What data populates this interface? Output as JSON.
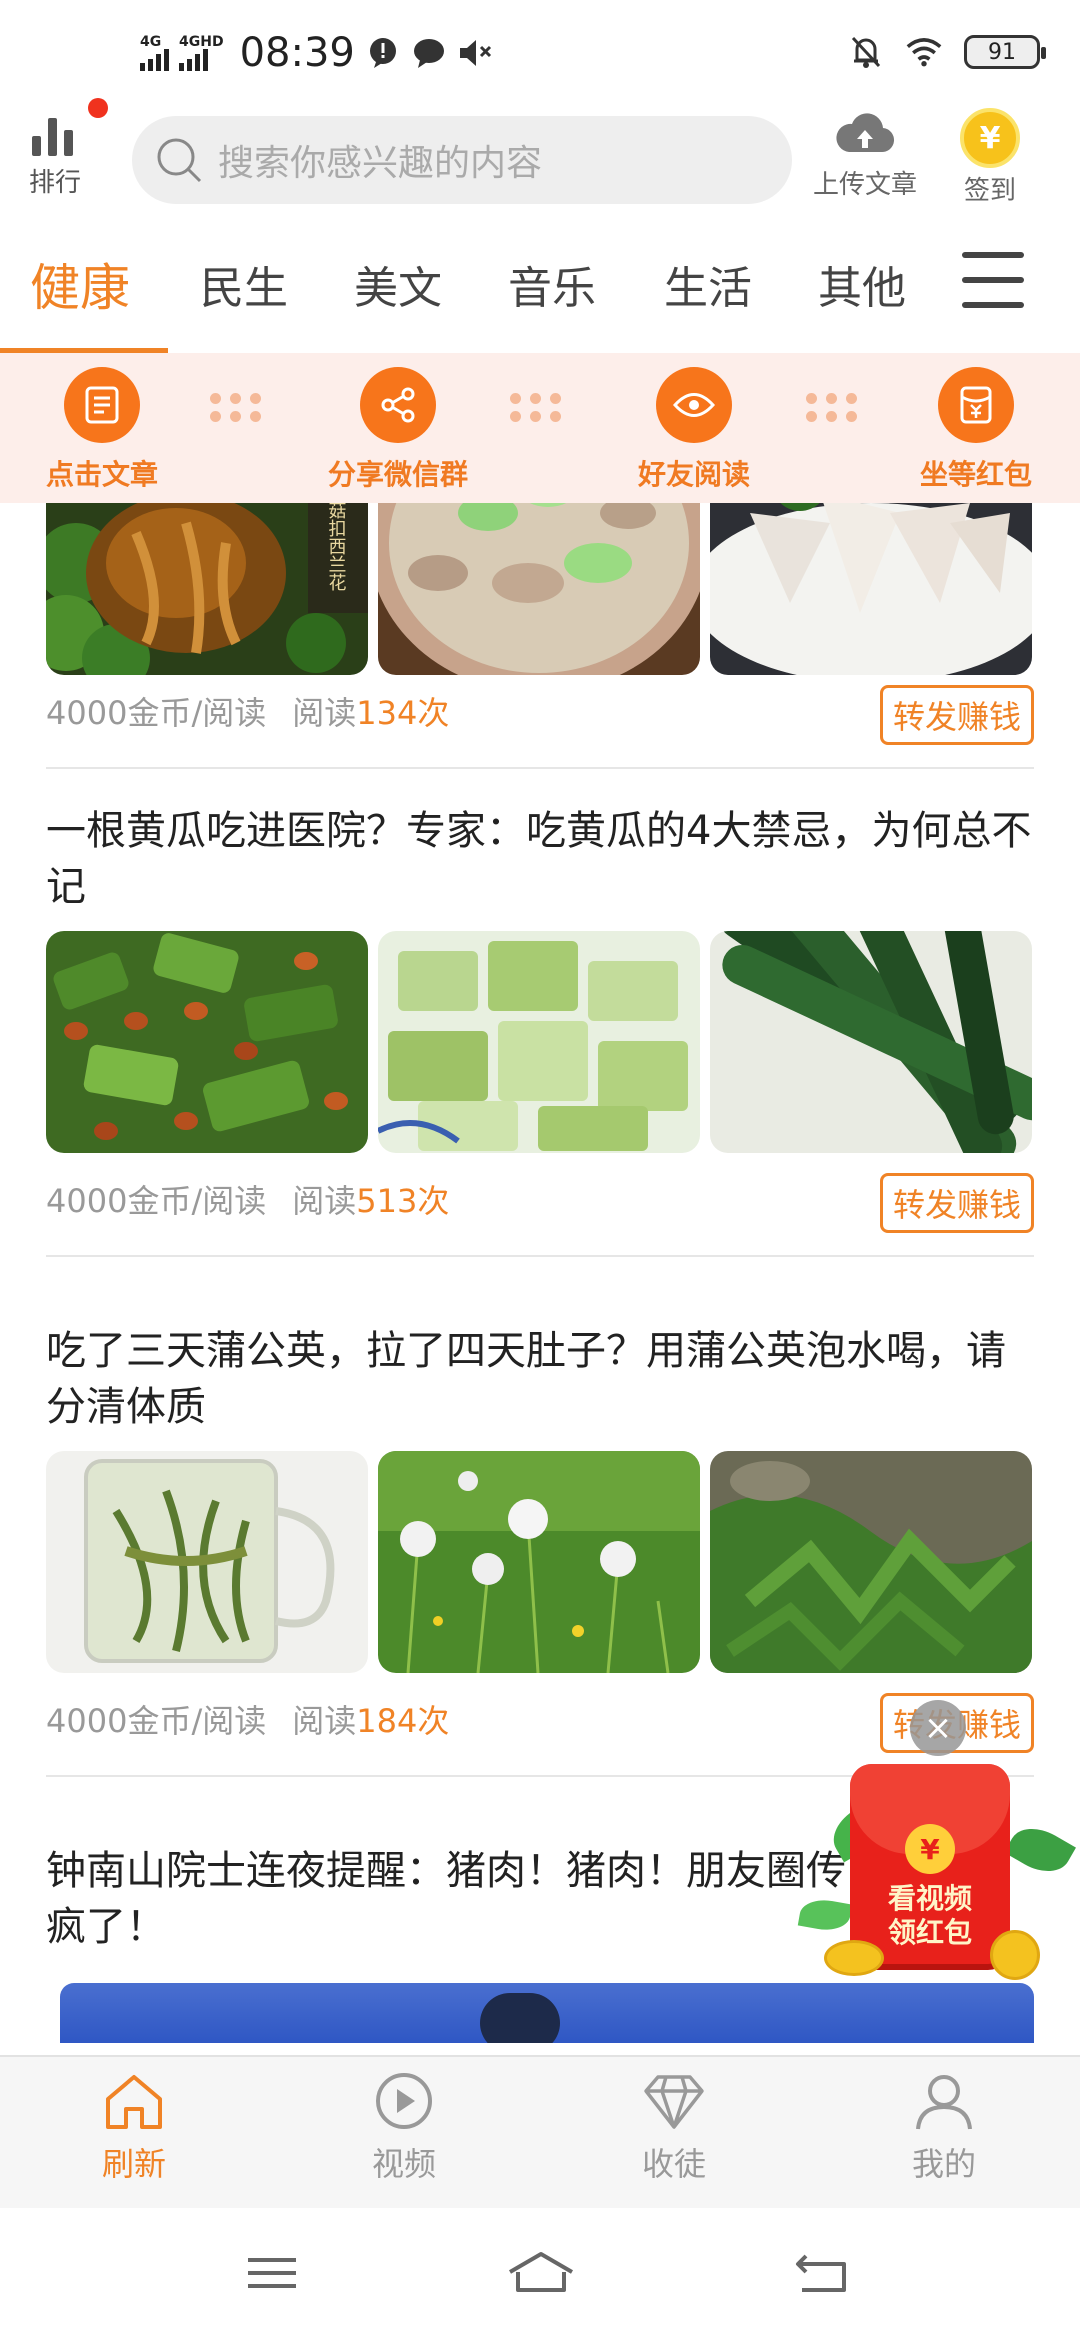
{
  "status_bar": {
    "net1": "4G",
    "net2": "4GHD",
    "time": "08:39",
    "battery": "91"
  },
  "header": {
    "rank_label": "排行",
    "search_placeholder": "搜索你感兴趣的内容",
    "upload_label": "上传文章",
    "checkin_label": "签到",
    "coin_symbol": "¥"
  },
  "tabs": [
    {
      "label": "健康",
      "active": true
    },
    {
      "label": "民生"
    },
    {
      "label": "美文"
    },
    {
      "label": "音乐"
    },
    {
      "label": "生活"
    },
    {
      "label": "其他"
    }
  ],
  "promo_steps": [
    {
      "label": "点击文章",
      "icon": "article-icon"
    },
    {
      "label": "分享微信群",
      "icon": "share-icon"
    },
    {
      "label": "好友阅读",
      "icon": "eye-icon"
    },
    {
      "label": "坐等红包",
      "icon": "red-envelope-icon"
    }
  ],
  "articles": [
    {
      "title": "",
      "rate": "4000金币/阅读",
      "reads_prefix": "阅读",
      "reads_count": "134次",
      "share_label": "转发赚钱",
      "image_caption": "草菇扣西兰花"
    },
    {
      "title": "一根黄瓜吃进医院？专家：吃黄瓜的4大禁忌，为何总不记",
      "rate": "4000金币/阅读",
      "reads_prefix": "阅读",
      "reads_count": "513次",
      "share_label": "转发赚钱"
    },
    {
      "title": "吃了三天蒲公英，拉了四天肚子？用蒲公英泡水喝，请分清体质",
      "rate": "4000金币/阅读",
      "reads_prefix": "阅读",
      "reads_count": "184次",
      "share_label": "转发赚钱"
    },
    {
      "title": "钟南山院士连夜提醒：猪肉！猪肉！朋友圈传疯了！"
    }
  ],
  "float_ad": {
    "coin_symbol": "¥",
    "line1": "看视频",
    "line2": "领红包",
    "close": "×"
  },
  "bottom_nav": [
    {
      "label": "刷新",
      "icon": "home-icon",
      "active": true
    },
    {
      "label": "视频",
      "icon": "play-icon"
    },
    {
      "label": "收徒",
      "icon": "diamond-icon"
    },
    {
      "label": "我的",
      "icon": "user-icon"
    }
  ],
  "colors": {
    "accent": "#f08326",
    "promo_bg": "#fdeeea",
    "promo_icon": "#f7751b",
    "red_packet": "#e8211b"
  }
}
